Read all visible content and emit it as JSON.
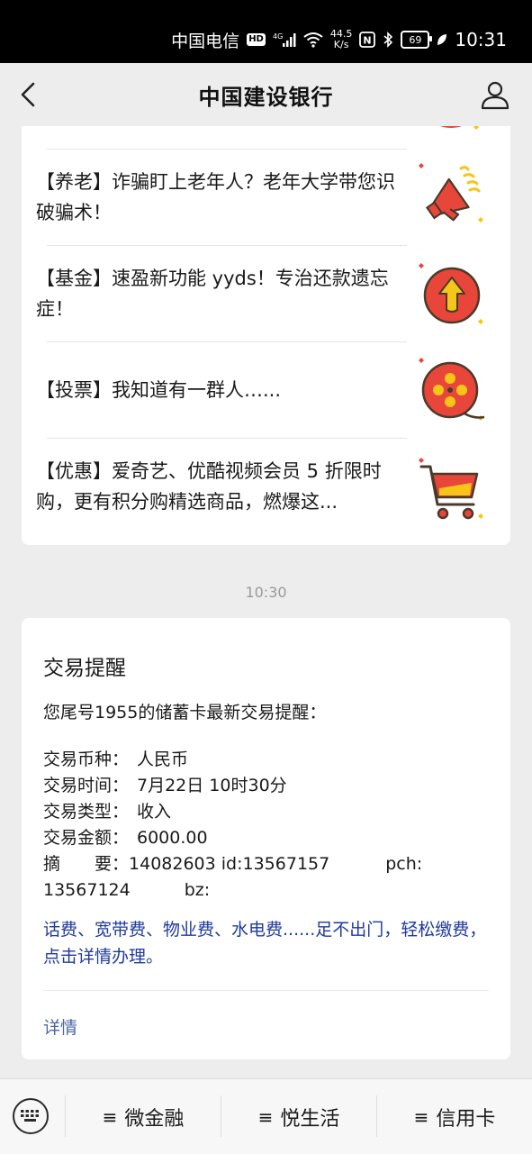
{
  "status_bar": {
    "carrier": "中国电信",
    "hd": "HD",
    "network": "4G",
    "speed_value": "44.5",
    "speed_unit": "K/s",
    "nfc": "N",
    "battery": "69",
    "time": "10:31"
  },
  "nav": {
    "title": "中国建设银行"
  },
  "news": {
    "items": [
      {
        "text": "【养老】诈骗盯上老年人？老年大学带您识破骗术！",
        "icon": "megaphone-icon"
      },
      {
        "text": "【基金】速盈新功能 yyds！专治还款遗忘症！",
        "icon": "arrow-up-coin-icon"
      },
      {
        "text": "【投票】我知道有一群人…...",
        "icon": "film-reel-icon"
      },
      {
        "text": "【优惠】爱奇艺、优酷视频会员 5 折限时购，更有积分购精选商品，燃爆这...",
        "icon": "shopping-cart-icon"
      }
    ]
  },
  "timestamp": "10:30",
  "transaction": {
    "title": "交易提醒",
    "intro": "您尾号1955的储蓄卡最新交易提醒：",
    "rows": [
      {
        "label": "交易币种：",
        "value": "人民币"
      },
      {
        "label": "交易时间：",
        "value": "7月22日 10时30分"
      },
      {
        "label": "交易类型：",
        "value": "收入"
      },
      {
        "label": "交易金额：",
        "value": "6000.00"
      }
    ],
    "summary_label": "摘　　要：",
    "summary_part1": "14082603 id:13567157",
    "summary_part2": "pch:",
    "summary_part3": "13567124",
    "summary_part4": "bz:",
    "promo": "话费、宽带费、物业费、水电费......足不出门，轻松缴费，点击详情办理。",
    "detail_link": "详情"
  },
  "bottom_menu": {
    "items": [
      {
        "label": "微金融"
      },
      {
        "label": "悦生活"
      },
      {
        "label": "信用卡"
      }
    ]
  },
  "colors": {
    "icon_red": "#e8463a",
    "icon_yellow": "#f5c518",
    "link_blue": "#1f3a9e",
    "detail_blue": "#4a67a8"
  }
}
